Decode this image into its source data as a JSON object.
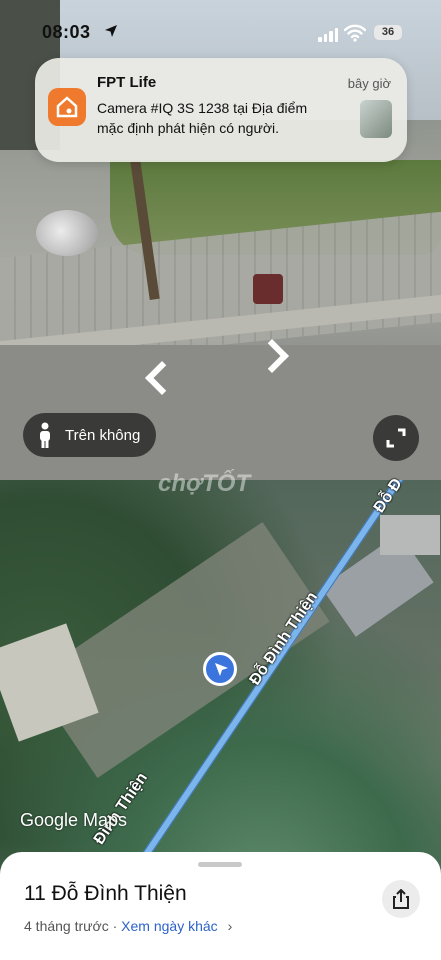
{
  "status_bar": {
    "time": "08:03",
    "battery": "36"
  },
  "notification": {
    "app_name": "FPT Life",
    "time": "bây giờ",
    "message": "Camera #IQ 3S 1238 tại Địa điểm mặc định phát hiện có người."
  },
  "street_view": {
    "mode_label": "Trên không"
  },
  "map": {
    "street_labels": [
      "Đỗ Đình Thiện",
      "Đỗ Đ",
      "Đình Thiện"
    ],
    "logo": "Google Maps",
    "watermark": "chợTỐT"
  },
  "sheet": {
    "address": "11 Đỗ Đình Thiện",
    "age": "4 tháng trước",
    "separator": "·",
    "other_dates": "Xem ngày khác",
    "chevron": "›"
  },
  "icons": [
    "location-arrow-icon",
    "signal-icon",
    "wifi-icon",
    "battery-icon",
    "house-icon",
    "person-icon",
    "expand-icon",
    "navigation-arrow-icon",
    "share-icon"
  ]
}
